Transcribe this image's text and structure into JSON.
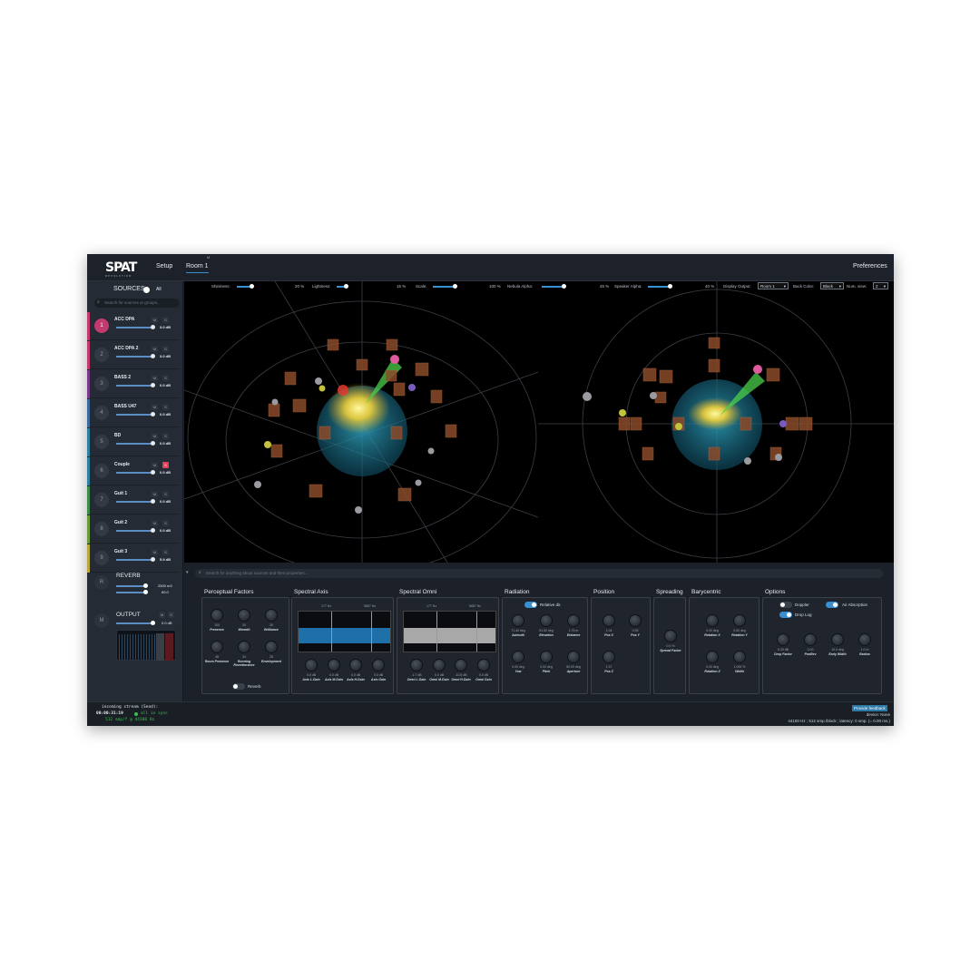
{
  "topbar": {
    "logo": "SPAT",
    "logo_sub": "REVOLUTION",
    "tab_setup": "Setup",
    "tab_room": "Room 1",
    "room_marker": "M",
    "preferences": "Preferences"
  },
  "sources": {
    "title": "SOURCES",
    "toggle_label": "All",
    "search_placeholder": "Search for sources or groups...",
    "items": [
      {
        "num": "1",
        "name": "ACC DPA",
        "db": "3.0 dB",
        "color": "#c23a6e",
        "active": true
      },
      {
        "num": "2",
        "name": "ACC DPA 2",
        "db": "3.0 dB",
        "color": "#c23a6e"
      },
      {
        "num": "3",
        "name": "BASS 2",
        "db": "0.0 dB",
        "color": "#7a3a8c"
      },
      {
        "num": "4",
        "name": "BASS U47",
        "db": "0.0 dB",
        "color": "#3a6a9c"
      },
      {
        "num": "5",
        "name": "BD",
        "db": "0.0 dB",
        "color": "#2f7fa0"
      },
      {
        "num": "6",
        "name": "Couple",
        "db": "0.0 dB",
        "color": "#2f7fa0"
      },
      {
        "num": "7",
        "name": "Guit 1",
        "db": "0.0 dB",
        "color": "#3e8c4a"
      },
      {
        "num": "8",
        "name": "Guit 2",
        "db": "0.0 dB",
        "color": "#6a9c3a"
      },
      {
        "num": "9",
        "name": "Guit 3",
        "db": "5.9 dB",
        "color": "#b8a73a"
      }
    ]
  },
  "reverb": {
    "icon": "R",
    "title": "REVERB",
    "val1": "2500 m3",
    "val2": "60.0"
  },
  "output": {
    "icon": "M",
    "title": "OUTPUT",
    "db": "0.0 dB"
  },
  "viewport": {
    "shininess_label": "Shininess:",
    "shininess_val": "20 %",
    "lightness_label": "Lightness:",
    "lightness_val": "15 %",
    "scale_label": "Scale:",
    "scale_val": "100 %",
    "nebula_label": "Nebula Alpha:",
    "nebula_val": "45 %",
    "speaker_label": "Speaker Alpha:",
    "speaker_val": "40 %",
    "display_output_label": "Display Output:",
    "display_output_val": "Room 1",
    "back_color_label": "Back Color:",
    "back_color_val": "Black",
    "num_view_label": "Num. view:",
    "num_view_val": "2"
  },
  "search": {
    "placeholder": "Search for anything about sources and their properties..."
  },
  "perceptual": {
    "title": "Perceptual Factors",
    "knobs": [
      {
        "val": "100",
        "lbl": "Presence"
      },
      {
        "val": "30",
        "lbl": "Warmth"
      },
      {
        "val": "30",
        "lbl": "Brilliance"
      },
      {
        "val": "48",
        "lbl": "Room Presence"
      },
      {
        "val": "34",
        "lbl": "Running Reverberance"
      },
      {
        "val": "25",
        "lbl": "Envelopment"
      }
    ],
    "reverb_toggle": "Reverb"
  },
  "spectral_axis": {
    "title": "Spectral Axis",
    "f1": "177 Hz",
    "f2": "5657 Hz",
    "scale": [
      "+20",
      "+10",
      "0",
      "-10",
      "-20"
    ],
    "knobs": [
      {
        "val": "0.0 dB",
        "lbl": "Axis L.Gain"
      },
      {
        "val": "0.0 dB",
        "lbl": "Axis M.Gain"
      },
      {
        "val": "0.0 dB",
        "lbl": "Axis H.Gain"
      },
      {
        "val": "0.0 dB",
        "lbl": "Axis Gain"
      }
    ]
  },
  "spectral_omni": {
    "title": "Spectral Omni",
    "f1": "177 Hz",
    "f2": "5657 Hz",
    "scale": [
      "+20",
      "+10",
      "0",
      "-10",
      "-20"
    ],
    "knobs": [
      {
        "val": "-1.7 dB",
        "lbl": "Omni L.Gain"
      },
      {
        "val": "0.0 dB",
        "lbl": "Omni M.Gain"
      },
      {
        "val": "-10.8 dB",
        "lbl": "Omni H.Gain"
      },
      {
        "val": "0.0 dB",
        "lbl": "Omni Gain"
      }
    ]
  },
  "radiation": {
    "title": "Radiation",
    "toggle": "Relative dir.",
    "knobs": [
      {
        "val": "71.40 deg",
        "lbl": "Azimuth"
      },
      {
        "val": "51.52 deg",
        "lbl": "Elevation"
      },
      {
        "val": "1.76 m",
        "lbl": "Distance"
      },
      {
        "val": "0.00 deg",
        "lbl": "Yaw"
      },
      {
        "val": "0.00 deg",
        "lbl": "Pitch"
      },
      {
        "val": "80.00 deg",
        "lbl": "Aperture"
      }
    ]
  },
  "position": {
    "title": "Position",
    "knobs": [
      {
        "val": "1.04",
        "lbl": "Pos X"
      },
      {
        "val": "0.35",
        "lbl": "Pos Y"
      },
      {
        "val": "1.37",
        "lbl": "Pos Z"
      }
    ]
  },
  "spreading": {
    "title": "Spreading",
    "knobs": [
      {
        "val": "0.0 %",
        "lbl": "Spread Factor"
      }
    ]
  },
  "barycentric": {
    "title": "Barycentric",
    "knobs": [
      {
        "val": "0.00 deg",
        "lbl": "Rotation X"
      },
      {
        "val": "0.00 deg",
        "lbl": "Rotation Y"
      },
      {
        "val": "0.00 deg",
        "lbl": "Rotation Z"
      },
      {
        "val": "1.000 %",
        "lbl": "Width"
      }
    ]
  },
  "options": {
    "title": "Options",
    "doppler": "Doppler",
    "air": "Air Absorption",
    "drop_log": "Drop Log",
    "knobs": [
      {
        "val": "6.00 dB",
        "lbl": "Drop Factor"
      },
      {
        "val": "0.00",
        "lbl": "PanRev"
      },
      {
        "val": "10.0 deg",
        "lbl": "Early Width"
      },
      {
        "val": "1.0 m",
        "lbl": "Radius"
      }
    ]
  },
  "footer": {
    "stream": "incoming stream (Send):",
    "time": "00:00:31:19",
    "sync": "all in sync",
    "rate": "512 smp/f @ 44100 Hz",
    "feedback": "Provide feedback",
    "device": "device: None",
    "status": "44100 Hz ; 512 smp./block ; latency: 0 smp. (= 0.00 ms.)"
  }
}
